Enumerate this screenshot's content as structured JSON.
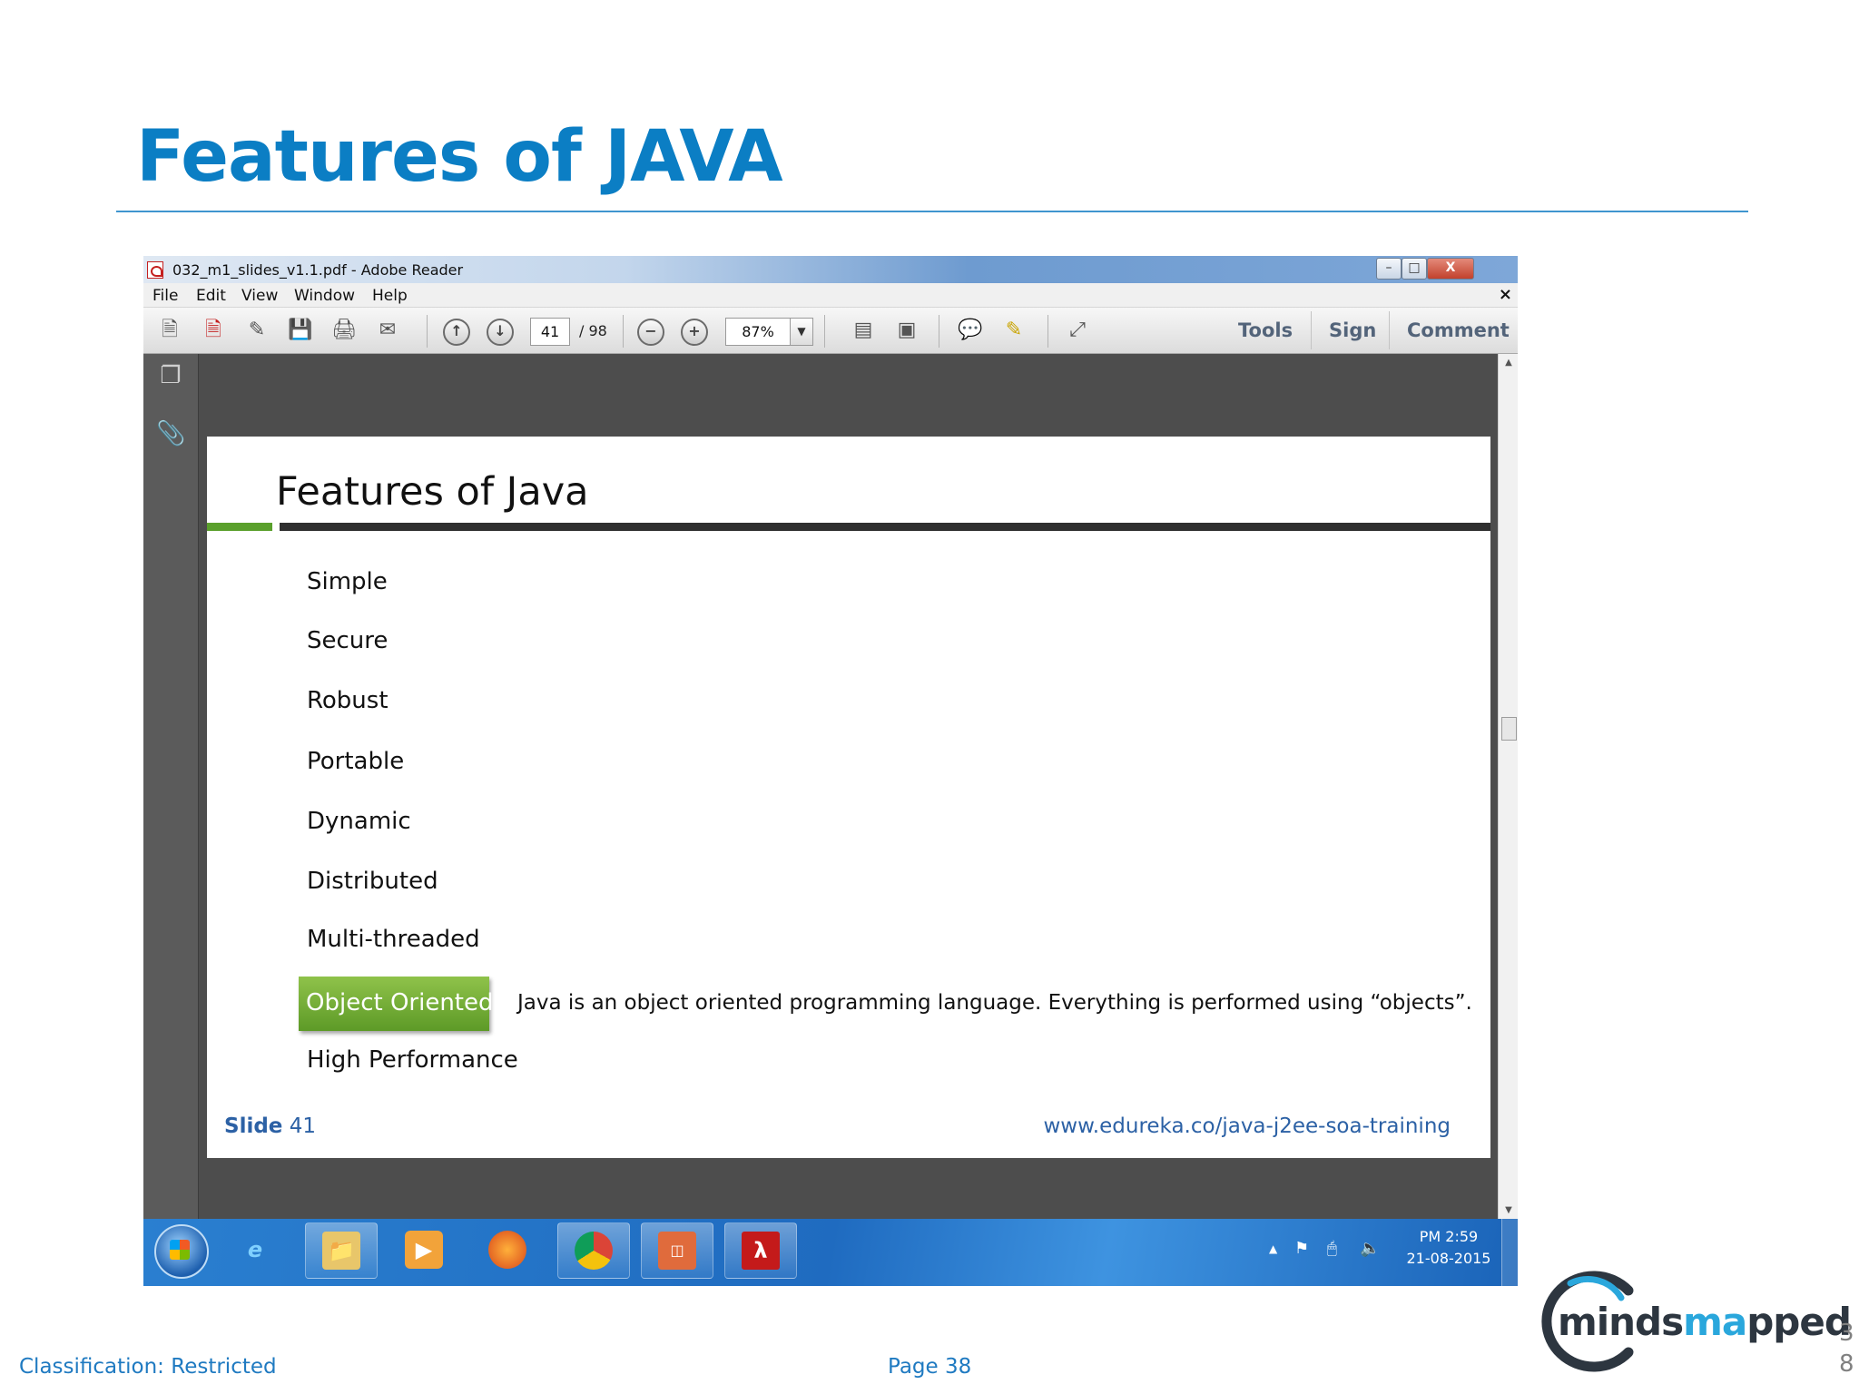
{
  "slide": {
    "title": "Features of JAVA",
    "footer_classification": "Classification: Restricted",
    "footer_page": "Page 38",
    "page_number_digits": [
      "3",
      "8"
    ],
    "logo": "mindsmapped"
  },
  "reader": {
    "window_title": "032_m1_slides_v1.1.pdf - Adobe Reader",
    "window_buttons": {
      "minimize": "–",
      "restore": "□",
      "close": "X"
    },
    "menu": [
      "File",
      "Edit",
      "View",
      "Window",
      "Help"
    ],
    "menu_close": "×",
    "toolbar": {
      "icons": [
        "create-pdf-icon",
        "export-pdf-icon",
        "edit-icon",
        "save-icon",
        "print-icon",
        "email-icon",
        "page-up-icon",
        "page-down-icon",
        "zoom-out-icon",
        "zoom-in-icon",
        "fit-width-icon",
        "fit-page-icon",
        "comment-icon",
        "highlight-icon",
        "fullscreen-icon"
      ],
      "page_current": "41",
      "page_total": "/ 98",
      "zoom": "87%",
      "tools_label": "Tools",
      "sign_label": "Sign",
      "comment_label": "Comment"
    },
    "left_panel_icons": [
      "pages-icon",
      "attachments-icon"
    ]
  },
  "pdf_page": {
    "title": "Features of Java",
    "items": [
      "Simple",
      "Secure",
      "Robust",
      "Portable",
      "Dynamic",
      "Distributed",
      "Multi-threaded",
      "Object Oriented",
      "High Performance"
    ],
    "highlighted_item": "Object Oriented",
    "highlight_description": "Java is an object oriented programming language. Everything is performed using “objects”.",
    "slide_label": "Slide",
    "slide_number": "41",
    "url": "www.edureka.co/java-j2ee-soa-training",
    "accent_green": "#5aa02c"
  },
  "taskbar": {
    "apps": [
      "start-button",
      "ie-icon",
      "explorer-icon",
      "media-player-icon",
      "firefox-icon",
      "chrome-icon",
      "presentation-app-icon",
      "adobe-reader-icon"
    ],
    "clock_time": "PM 2:59",
    "clock_date": "21-08-2015"
  },
  "colors": {
    "title_blue": "#0b7ec4",
    "taskbar_blue": "#1f6bc0",
    "link_blue": "#2c61a5"
  }
}
